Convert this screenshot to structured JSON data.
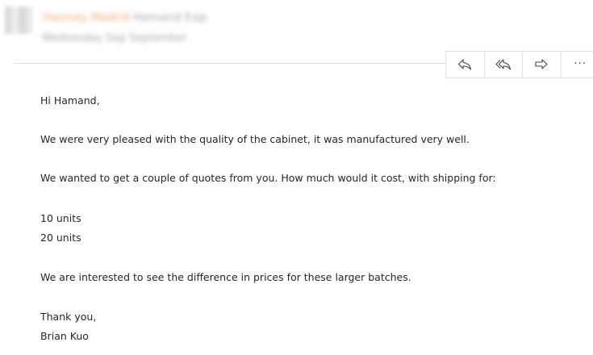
{
  "sender": {
    "name": "Vianney Madrid",
    "organization": "Hamand Export Group Ltd",
    "recipient_line": "Wednesday Sep September"
  },
  "toolbar": {
    "buttons": [
      {
        "icon": "reply-icon"
      },
      {
        "icon": "reply-all-icon"
      },
      {
        "icon": "forward-icon"
      },
      {
        "icon": "more-options-icon",
        "label": "···"
      }
    ]
  },
  "message": {
    "greeting": "Hi Hamand,",
    "line1": "We were very pleased with the quality of the cabinet, it was manufactured very well.",
    "line2": "We wanted to get a couple of quotes from you.  How much would it cost, with shipping for:",
    "qty1": "10 units",
    "qty2": "20 units",
    "line3": "We are interested to see the difference in prices for these larger batches.",
    "closing": "Thank you,",
    "signature": "Brian Kuo"
  },
  "colors": {
    "sender_name": "#f0a67d",
    "border": "#e1e1e1",
    "text": "#262626"
  }
}
